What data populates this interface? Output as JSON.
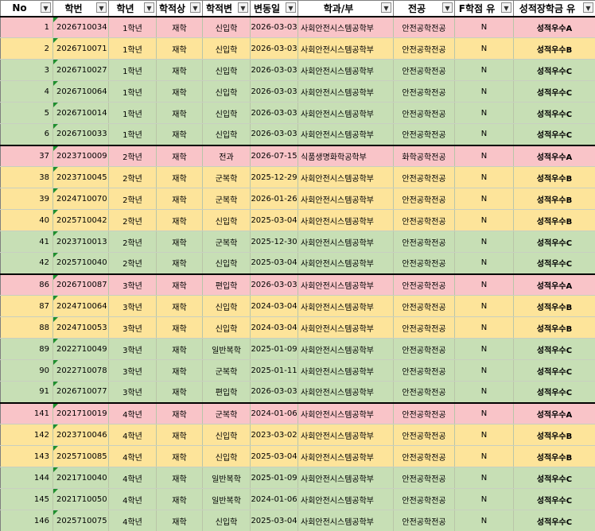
{
  "headers": [
    "No",
    "학번",
    "학년",
    "학적상",
    "학적변",
    "변동일",
    "학과/부",
    "전공",
    "F학점 유",
    "성적장학금 유"
  ],
  "colors": {
    "red": "#f9c4c8",
    "yellow": "#fde49a",
    "green": "#c7dfb5"
  },
  "rows": [
    {
      "no": "1",
      "id": "2026710034",
      "grade": "1학년",
      "status": "재학",
      "change": "신입학",
      "date": "2026-03-03",
      "dept": "사회안전시스템공학부",
      "major": "안전공학전공",
      "f": "N",
      "sch": "성적우수A",
      "color": "red",
      "start": true
    },
    {
      "no": "2",
      "id": "2026710071",
      "grade": "1학년",
      "status": "재학",
      "change": "신입학",
      "date": "2026-03-03",
      "dept": "사회안전시스템공학부",
      "major": "안전공학전공",
      "f": "N",
      "sch": "성적우수B",
      "color": "yellow"
    },
    {
      "no": "3",
      "id": "2026710027",
      "grade": "1학년",
      "status": "재학",
      "change": "신입학",
      "date": "2026-03-03",
      "dept": "사회안전시스템공학부",
      "major": "안전공학전공",
      "f": "N",
      "sch": "성적우수C",
      "color": "green"
    },
    {
      "no": "4",
      "id": "2026710064",
      "grade": "1학년",
      "status": "재학",
      "change": "신입학",
      "date": "2026-03-03",
      "dept": "사회안전시스템공학부",
      "major": "안전공학전공",
      "f": "N",
      "sch": "성적우수C",
      "color": "green"
    },
    {
      "no": "5",
      "id": "2026710014",
      "grade": "1학년",
      "status": "재학",
      "change": "신입학",
      "date": "2026-03-03",
      "dept": "사회안전시스템공학부",
      "major": "안전공학전공",
      "f": "N",
      "sch": "성적우수C",
      "color": "green"
    },
    {
      "no": "6",
      "id": "2026710033",
      "grade": "1학년",
      "status": "재학",
      "change": "신입학",
      "date": "2026-03-03",
      "dept": "사회안전시스템공학부",
      "major": "안전공학전공",
      "f": "N",
      "sch": "성적우수C",
      "color": "green"
    },
    {
      "no": "37",
      "id": "2023710009",
      "grade": "2학년",
      "status": "재학",
      "change": "전과",
      "date": "2026-07-15",
      "dept": "식품생명화학공학부",
      "major": "화학공학전공",
      "f": "N",
      "sch": "성적우수A",
      "color": "red",
      "start": true
    },
    {
      "no": "38",
      "id": "2023710045",
      "grade": "2학년",
      "status": "재학",
      "change": "군복학",
      "date": "2025-12-29",
      "dept": "사회안전시스템공학부",
      "major": "안전공학전공",
      "f": "N",
      "sch": "성적우수B",
      "color": "yellow"
    },
    {
      "no": "39",
      "id": "2024710070",
      "grade": "2학년",
      "status": "재학",
      "change": "군복학",
      "date": "2026-01-26",
      "dept": "사회안전시스템공학부",
      "major": "안전공학전공",
      "f": "N",
      "sch": "성적우수B",
      "color": "yellow"
    },
    {
      "no": "40",
      "id": "2025710042",
      "grade": "2학년",
      "status": "재학",
      "change": "신입학",
      "date": "2025-03-04",
      "dept": "사회안전시스템공학부",
      "major": "안전공학전공",
      "f": "N",
      "sch": "성적우수B",
      "color": "yellow"
    },
    {
      "no": "41",
      "id": "2023710013",
      "grade": "2학년",
      "status": "재학",
      "change": "군복학",
      "date": "2025-12-30",
      "dept": "사회안전시스템공학부",
      "major": "안전공학전공",
      "f": "N",
      "sch": "성적우수C",
      "color": "green"
    },
    {
      "no": "42",
      "id": "2025710040",
      "grade": "2학년",
      "status": "재학",
      "change": "신입학",
      "date": "2025-03-04",
      "dept": "사회안전시스템공학부",
      "major": "안전공학전공",
      "f": "N",
      "sch": "성적우수C",
      "color": "green"
    },
    {
      "no": "86",
      "id": "2026710087",
      "grade": "3학년",
      "status": "재학",
      "change": "편입학",
      "date": "2026-03-03",
      "dept": "사회안전시스템공학부",
      "major": "안전공학전공",
      "f": "N",
      "sch": "성적우수A",
      "color": "red",
      "start": true
    },
    {
      "no": "87",
      "id": "2024710064",
      "grade": "3학년",
      "status": "재학",
      "change": "신입학",
      "date": "2024-03-04",
      "dept": "사회안전시스템공학부",
      "major": "안전공학전공",
      "f": "N",
      "sch": "성적우수B",
      "color": "yellow"
    },
    {
      "no": "88",
      "id": "2024710053",
      "grade": "3학년",
      "status": "재학",
      "change": "신입학",
      "date": "2024-03-04",
      "dept": "사회안전시스템공학부",
      "major": "안전공학전공",
      "f": "N",
      "sch": "성적우수B",
      "color": "yellow"
    },
    {
      "no": "89",
      "id": "2022710049",
      "grade": "3학년",
      "status": "재학",
      "change": "일반복학",
      "date": "2025-01-09",
      "dept": "사회안전시스템공학부",
      "major": "안전공학전공",
      "f": "N",
      "sch": "성적우수C",
      "color": "green"
    },
    {
      "no": "90",
      "id": "2022710078",
      "grade": "3학년",
      "status": "재학",
      "change": "군복학",
      "date": "2025-01-11",
      "dept": "사회안전시스템공학부",
      "major": "안전공학전공",
      "f": "N",
      "sch": "성적우수C",
      "color": "green"
    },
    {
      "no": "91",
      "id": "2026710077",
      "grade": "3학년",
      "status": "재학",
      "change": "편입학",
      "date": "2026-03-03",
      "dept": "사회안전시스템공학부",
      "major": "안전공학전공",
      "f": "N",
      "sch": "성적우수C",
      "color": "green"
    },
    {
      "no": "141",
      "id": "2021710019",
      "grade": "4학년",
      "status": "재학",
      "change": "군복학",
      "date": "2024-01-06",
      "dept": "사회안전시스템공학부",
      "major": "안전공학전공",
      "f": "N",
      "sch": "성적우수A",
      "color": "red",
      "start": true
    },
    {
      "no": "142",
      "id": "2023710046",
      "grade": "4학년",
      "status": "재학",
      "change": "신입학",
      "date": "2023-03-02",
      "dept": "사회안전시스템공학부",
      "major": "안전공학전공",
      "f": "N",
      "sch": "성적우수B",
      "color": "yellow",
      "dashed": true
    },
    {
      "no": "143",
      "id": "2025710085",
      "grade": "4학년",
      "status": "재학",
      "change": "신입학",
      "date": "2025-03-04",
      "dept": "사회안전시스템공학부",
      "major": "안전공학전공",
      "f": "N",
      "sch": "성적우수B",
      "color": "yellow"
    },
    {
      "no": "144",
      "id": "2021710040",
      "grade": "4학년",
      "status": "재학",
      "change": "일반복학",
      "date": "2025-01-09",
      "dept": "사회안전시스템공학부",
      "major": "안전공학전공",
      "f": "N",
      "sch": "성적우수C",
      "color": "green"
    },
    {
      "no": "145",
      "id": "2021710050",
      "grade": "4학년",
      "status": "재학",
      "change": "일반복학",
      "date": "2024-01-06",
      "dept": "사회안전시스템공학부",
      "major": "안전공학전공",
      "f": "N",
      "sch": "성적우수C",
      "color": "green"
    },
    {
      "no": "146",
      "id": "2025710075",
      "grade": "4학년",
      "status": "재학",
      "change": "신입학",
      "date": "2025-03-04",
      "dept": "사회안전시스템공학부",
      "major": "안전공학전공",
      "f": "N",
      "sch": "성적우수C",
      "color": "green"
    }
  ]
}
